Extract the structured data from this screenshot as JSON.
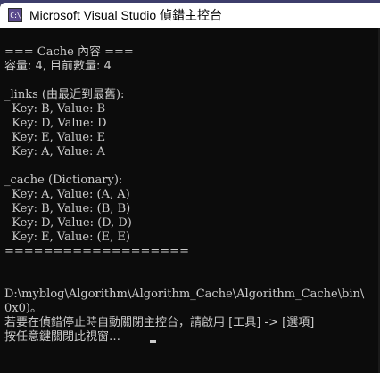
{
  "window": {
    "title": "Microsoft Visual Studio 偵錯主控台",
    "icon": "console-app-icon",
    "icon_label": "C:\\"
  },
  "console": {
    "lines": [
      "=== Cache 內容 ===",
      "容量: 4, 目前數量: 4",
      "",
      "_links (由最近到最舊):",
      "  Key: B, Value: B",
      "  Key: D, Value: D",
      "  Key: E, Value: E",
      "  Key: A, Value: A",
      "",
      "_cache (Dictionary):",
      "  Key: A, Value: (A, A)",
      "  Key: B, Value: (B, B)",
      "  Key: D, Value: (D, D)",
      "  Key: E, Value: (E, E)",
      "===================",
      "",
      "",
      "",
      "D:\\myblog\\Algorithm\\Algorithm_Cache\\Algorithm_Cache\\bin\\",
      "0x0)。",
      "若要在偵錯停止時自動關閉主控台，請啟用 [工具] -> [選項]",
      "按任意鍵關閉此視窗…"
    ]
  }
}
